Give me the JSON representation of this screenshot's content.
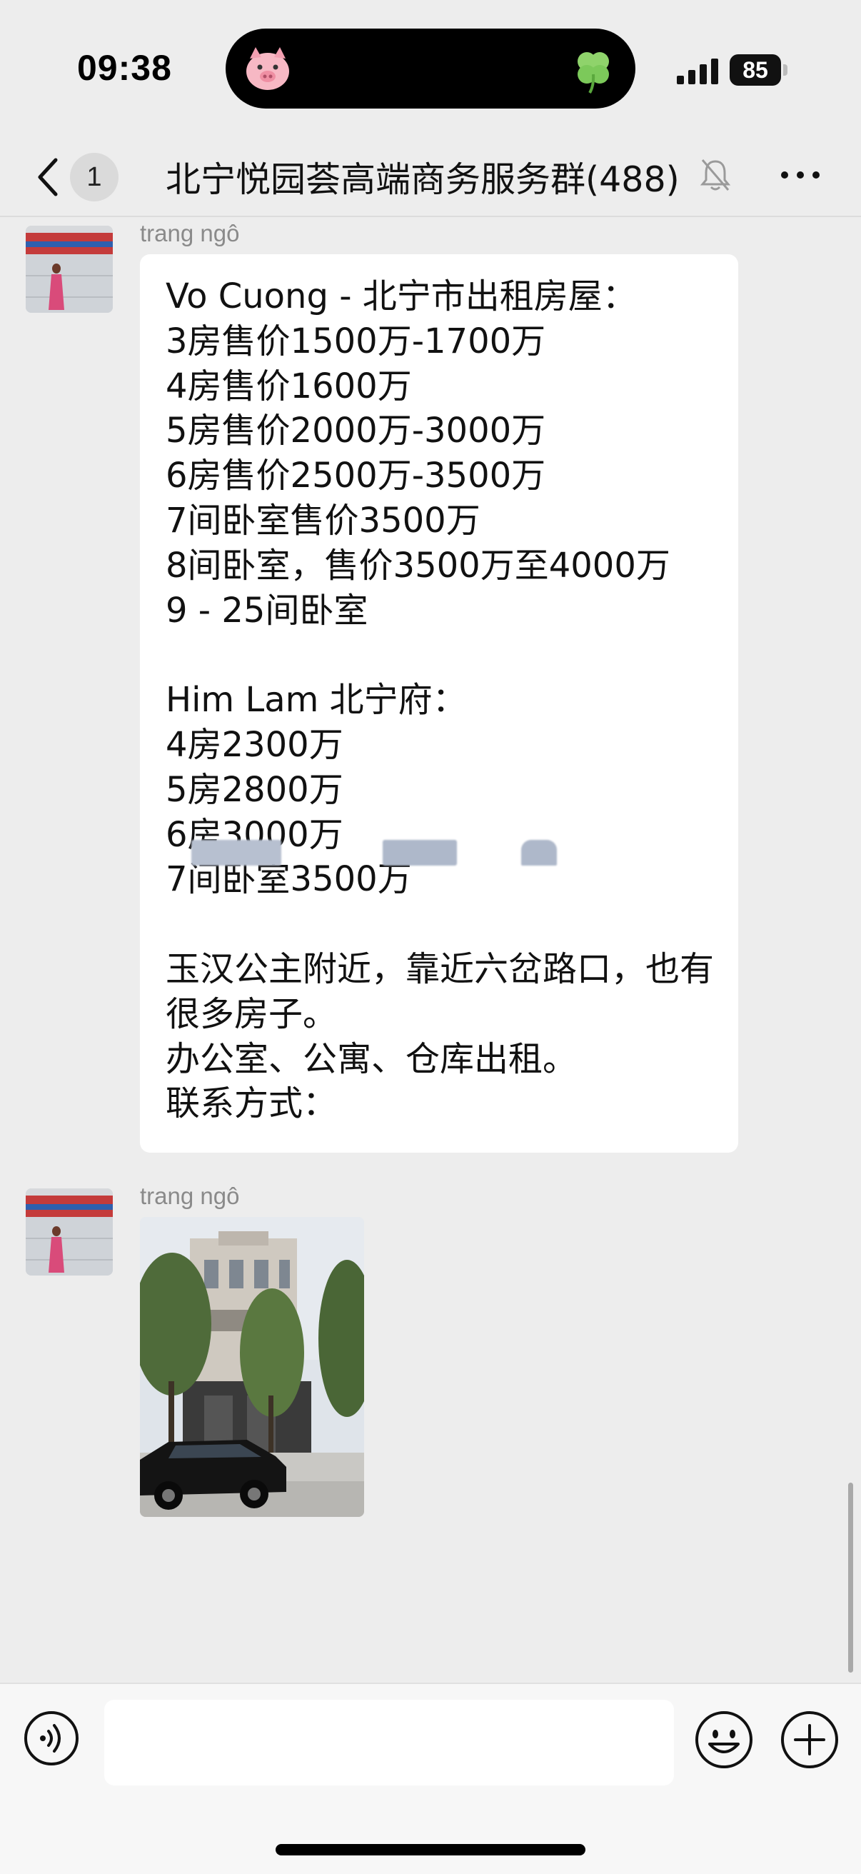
{
  "status_bar": {
    "time": "09:38",
    "battery": "85",
    "island_icons": [
      "pig-face-icon",
      "four-leaf-clover-icon"
    ]
  },
  "nav": {
    "unread_count": "1",
    "title": "北宁悦园荟高端商务服务群(488)",
    "icons": [
      "chevron-left-icon",
      "muted-bell-icon",
      "more-dots-icon"
    ]
  },
  "messages": [
    {
      "sender": "trang ngô",
      "type": "text",
      "text": "Vo Cuong - 北宁市出租房屋：\n3房售价1500万-1700万\n4房售价1600万\n5房售价2000万-3000万\n6房售价2500万-3500万\n7间卧室售价3500万\n8间卧室，售价3500万至4000万\n9 - 25间卧室\n\nHim Lam 北宁府：\n4房2300万\n5房2800万\n6房3000万\n7间卧室3500万\n\n玉汉公主附近，靠近六岔路口，也有很多房子。\n办公室、公寓、仓库出租。\n联系方式："
    },
    {
      "sender": "trang ngô",
      "type": "image"
    }
  ],
  "input_bar": {
    "placeholder": "",
    "icons": [
      "voice-wave-icon",
      "emoji-smile-icon",
      "plus-circle-icon"
    ]
  },
  "colors": {
    "background": "#ededed",
    "bubble": "#ffffff",
    "sender_name": "#8a8a8a",
    "redacted": "#b7c0d0"
  }
}
